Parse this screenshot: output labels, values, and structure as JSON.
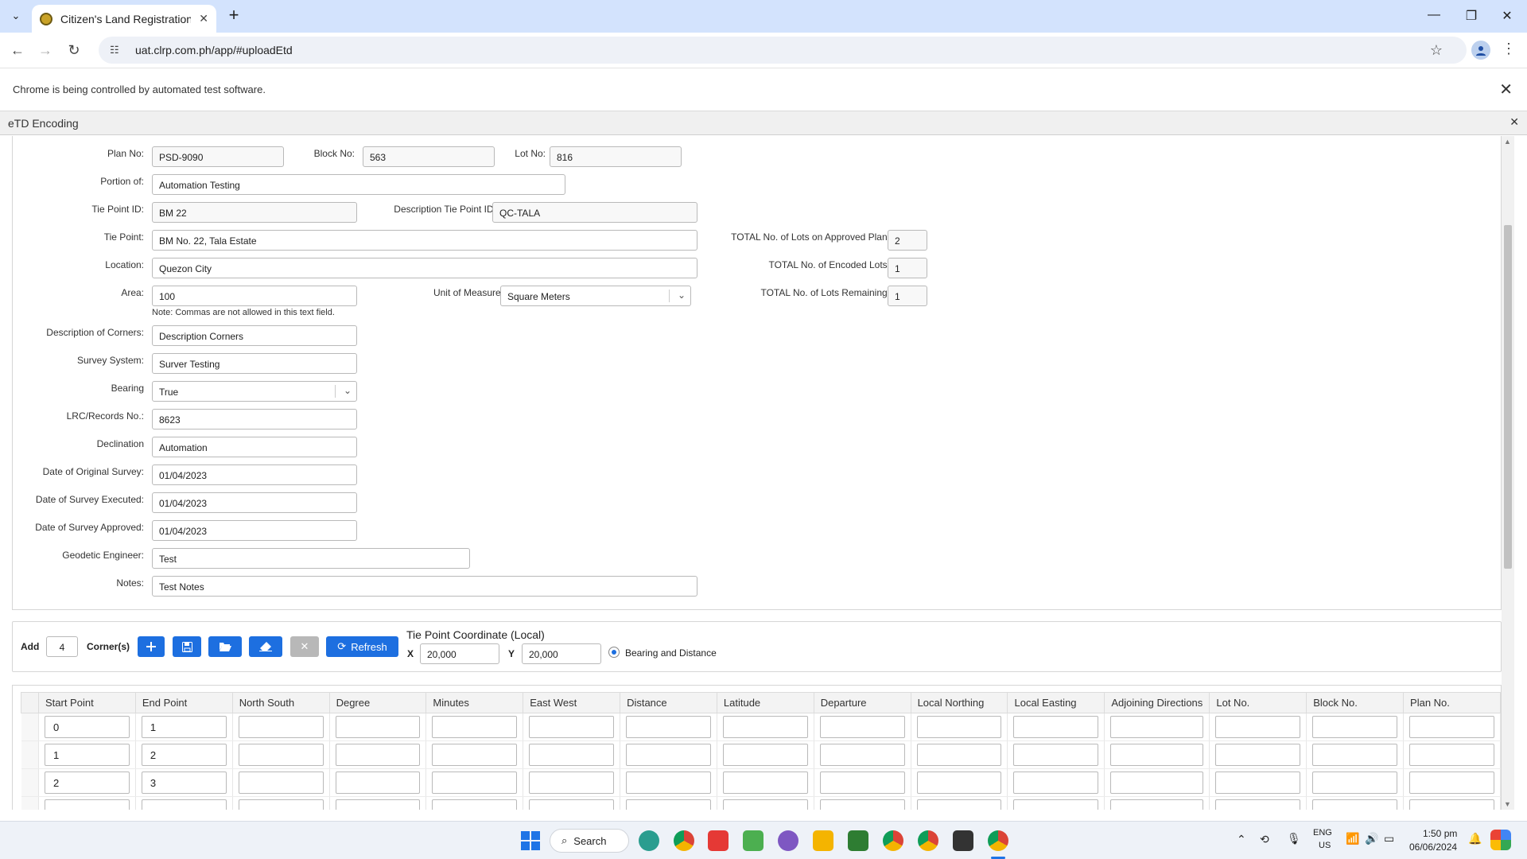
{
  "browser": {
    "tab_title": "Citizen's Land Registration Port",
    "url": "uat.clrp.com.ph/app/#uploadEtd",
    "infobar_message": "Chrome is being controlled by automated test software."
  },
  "panel": {
    "title": "eTD Encoding"
  },
  "form": {
    "plan_no_label": "Plan No:",
    "plan_no": "PSD-9090",
    "block_no_label": "Block No:",
    "block_no": "563",
    "lot_no_label": "Lot No:",
    "lot_no": "816",
    "portion_of_label": "Portion of:",
    "portion_of": "Automation Testing",
    "tie_point_id_label": "Tie Point ID:",
    "tie_point_id": "BM 22",
    "desc_tie_point_id_label": "Description Tie Point ID:",
    "desc_tie_point_id": "QC-TALA",
    "tie_point_label": "Tie Point:",
    "tie_point": "BM No. 22, Tala Estate",
    "location_label": "Location:",
    "location": "Quezon City",
    "area_label": "Area:",
    "area": "100",
    "area_note": "Note: Commas are not allowed in this text field.",
    "unit_of_measure_label": "Unit of Measure:",
    "unit_of_measure": "Square Meters",
    "total_lots_approved_label": "TOTAL No. of Lots on Approved Plan:",
    "total_lots_approved": "2",
    "total_encoded_label": "TOTAL No. of Encoded Lots:",
    "total_encoded": "1",
    "total_remaining_label": "TOTAL No. of Lots Remaining:",
    "total_remaining": "1",
    "desc_corners_label": "Description of Corners:",
    "desc_corners": "Description Corners",
    "survey_system_label": "Survey System:",
    "survey_system": "Surver Testing",
    "bearing_label": "Bearing",
    "bearing": "True",
    "lrc_label": "LRC/Records No.:",
    "lrc": "8623",
    "declination_label": "Declination",
    "declination": "Automation",
    "date_original_label": "Date of Original Survey:",
    "date_original": "01/04/2023",
    "date_executed_label": "Date of Survey Executed:",
    "date_executed": "01/04/2023",
    "date_approved_label": "Date of Survey Approved:",
    "date_approved": "01/04/2023",
    "geodetic_label": "Geodetic Engineer:",
    "geodetic": "Test",
    "notes_label": "Notes:",
    "notes": "Test Notes"
  },
  "corners": {
    "add_label": "Add",
    "count": "4",
    "corners_label": "Corner(s)",
    "refresh_label": "Refresh",
    "tie_point_coord_label": "Tie Point Coordinate (Local)",
    "x_label": "X",
    "x_value": "20,000",
    "y_label": "Y",
    "y_value": "20,000",
    "radio_label": "Bearing and Distance"
  },
  "grid": {
    "columns": [
      "Start Point",
      "End Point",
      "North South",
      "Degree",
      "Minutes",
      "East West",
      "Distance",
      "Latitude",
      "Departure",
      "Local Northing",
      "Local Easting",
      "Adjoining Directions",
      "Lot No.",
      "Block No.",
      "Plan No."
    ],
    "rows": [
      {
        "start": "0",
        "end": "1"
      },
      {
        "start": "1",
        "end": "2"
      },
      {
        "start": "2",
        "end": "3"
      }
    ]
  },
  "taskbar": {
    "search_label": "Search",
    "lang": "ENG",
    "region": "US",
    "time": "1:50 pm",
    "date": "06/06/2024"
  },
  "colors": {
    "accent": "#1d6fe0",
    "tab_strip": "#d3e3fd"
  }
}
